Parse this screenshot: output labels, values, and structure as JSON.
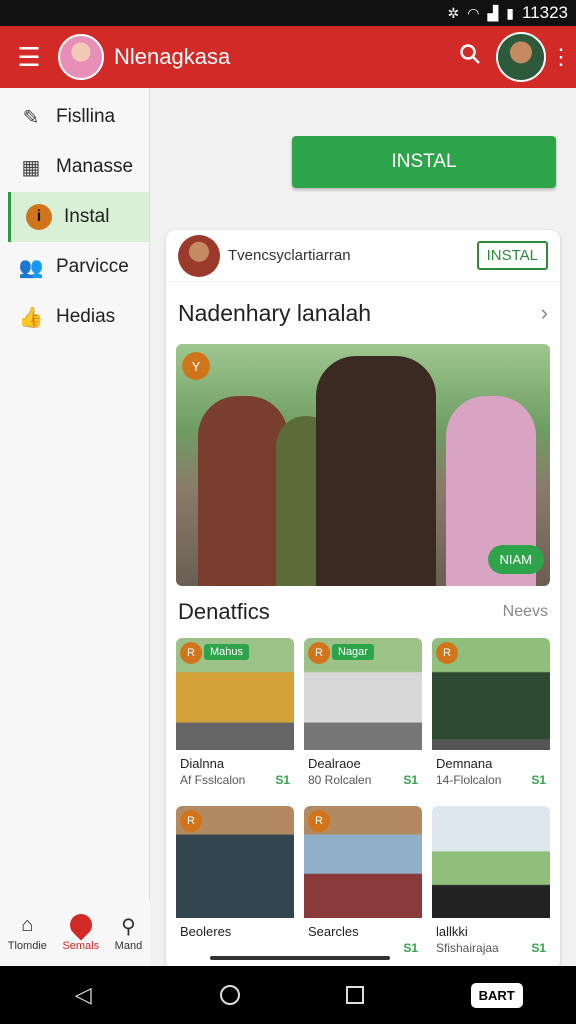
{
  "status": {
    "time": "11323"
  },
  "app_bar": {
    "title": "Nlenagkasa"
  },
  "sidebar": {
    "items": [
      {
        "label": "Fisllina",
        "icon": "tag-icon",
        "active": false
      },
      {
        "label": "Manasse",
        "icon": "calendar-icon",
        "active": false
      },
      {
        "label": "Instal",
        "icon": "info-icon",
        "active": true
      },
      {
        "label": "Parvicce",
        "icon": "people-icon",
        "active": false
      },
      {
        "label": "Hedias",
        "icon": "thumbs-up-icon",
        "active": false
      }
    ]
  },
  "top_install": {
    "label": "INSTAL"
  },
  "card": {
    "user": "Tvencsyclartiarran",
    "install_label": "INSTAL",
    "featured_title": "Nadenhary lanalah",
    "hero": {
      "badge": "Y",
      "pill": "NIAM"
    },
    "section_title": "Denatfics",
    "section_link": "Neevs",
    "tiles": [
      {
        "badge": "R",
        "tag": "Mahus",
        "name": "Dialnna",
        "meta": "Af Fsslcalon",
        "price": "S1"
      },
      {
        "badge": "R",
        "tag": "Nagar",
        "name": "Dealraoe",
        "meta": "80 Rolcalen",
        "price": "S1"
      },
      {
        "badge": "R",
        "tag": "",
        "name": "Demnana",
        "meta": "14-Flolcalon",
        "price": "S1"
      },
      {
        "badge": "R",
        "tag": "",
        "name": "Beoleres",
        "meta": "",
        "price": ""
      },
      {
        "badge": "R",
        "tag": "",
        "name": "Searcles",
        "meta": "",
        "price": "S1"
      },
      {
        "badge": "",
        "tag": "",
        "name": "lallkki",
        "meta": "Sfishairajaa",
        "price": "S1"
      }
    ]
  },
  "bottom_nav": {
    "items": [
      {
        "label": "Tlomdie"
      },
      {
        "label": "Semals"
      },
      {
        "label": "Mand"
      }
    ]
  },
  "system_nav": {
    "chip": "BART"
  },
  "colors": {
    "brand_red": "#d12a27",
    "accent_green": "#2ea44a",
    "accent_orange": "#d1751d"
  }
}
